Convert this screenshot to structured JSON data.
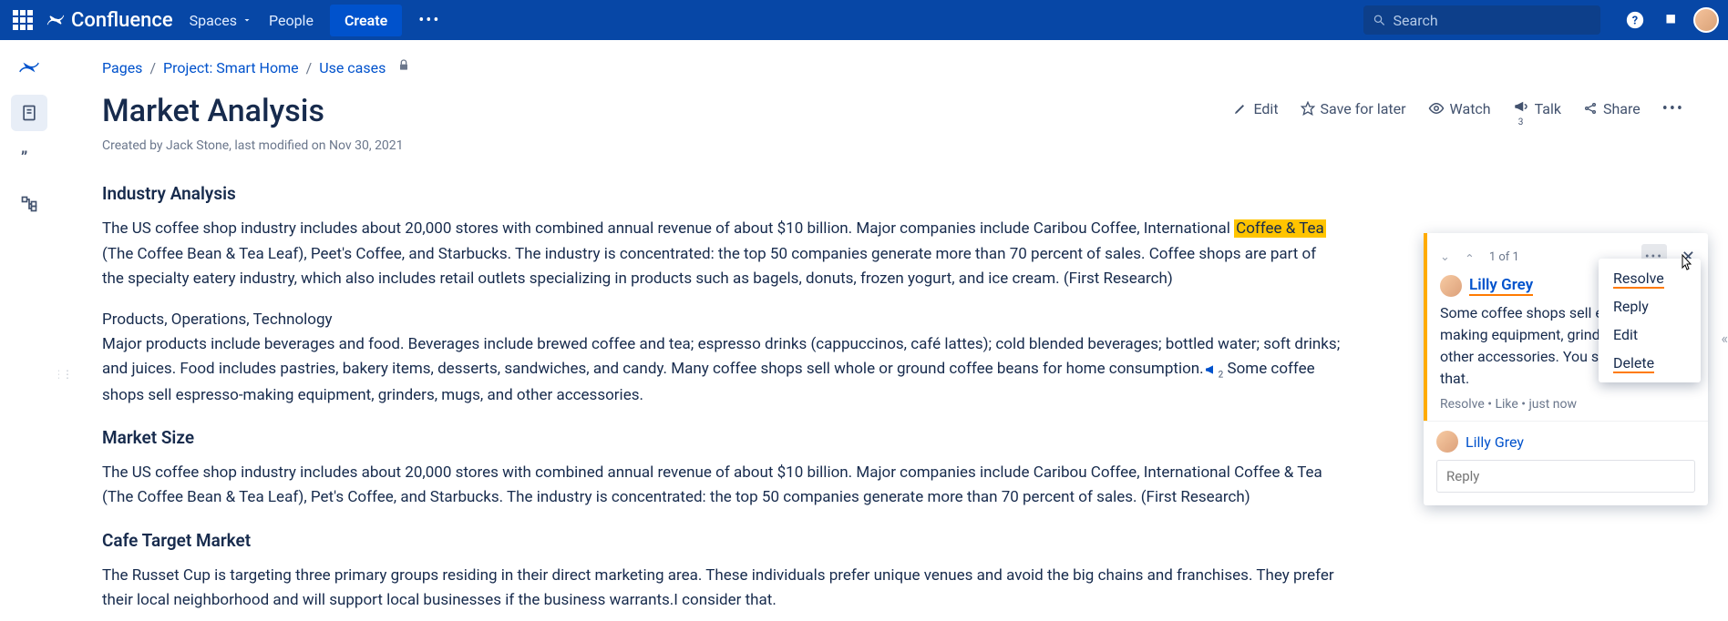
{
  "nav": {
    "brand": "Confluence",
    "spaces": "Spaces",
    "people": "People",
    "create": "Create",
    "search_placeholder": "Search"
  },
  "breadcrumbs": {
    "pages": "Pages",
    "project": "Project: Smart Home",
    "usecases": "Use cases"
  },
  "actions": {
    "edit": "Edit",
    "save": "Save for later",
    "watch": "Watch",
    "talk": "Talk",
    "share": "Share",
    "talk_count": "3"
  },
  "page": {
    "title": "Market Analysis",
    "byline": "Created by Jack Stone, last modified on Nov 30, 2021"
  },
  "article": {
    "h_industry": "Industry Analysis",
    "p_industry_a": "The US coffee shop industry includes about 20,000 stores with combined annual revenue of about $10 billion. Major companies include Caribou Coffee, International ",
    "p_industry_hl": "Coffee & Tea",
    "p_industry_b": " (The Coffee Bean & Tea Leaf), Peet's Coffee, and Starbucks. The industry is concentrated: the top 50 companies generate more than 70 percent of sales. Coffee shops are part of the specialty eatery industry, which also includes retail outlets specializing in products such as bagels, donuts, frozen yogurt, and ice cream. (First Research)",
    "p_products_head": "Products, Operations, Technology",
    "p_products_a": "Major products include beverages and food. Beverages include brewed coffee and tea; espresso drinks (cappuccinos, café lattes); cold blended beverages; bottled water; soft drinks; and juices. Food includes pastries, bakery items, desserts, sandwiches, and candy. Many coffee shops sell whole or ground coffee beans for home consumption.",
    "p_products_sub": "2",
    "p_products_b": " Some coffee shops sell espresso-making equipment, grinders, mugs, and other accessories.",
    "h_market": "Market Size",
    "p_market": "The US coffee shop industry includes about 20,000 stores with combined annual revenue of about $10 billion. Major companies include Caribou Coffee, International Coffee & Tea (The Coffee Bean & Tea Leaf), Pet's Coffee, and Starbucks. The industry is concentrated: the top 50 companies generate more than 70 percent of sales. (First Research)",
    "h_cafe": "Cafe Target Market",
    "p_cafe": "The Russet Cup is targeting three primary groups residing in their direct marketing area. These individuals prefer unique venues and avoid the big chains and franchises. They prefer their local neighborhood and will support local businesses if the business warrants.I consider that."
  },
  "comment": {
    "counter": "1 of 1",
    "author": "Lilly Grey",
    "body": "Some coffee shops sell espresso-making equipment, grinders, mugs, and other accessories. You should add that.",
    "footer": "Resolve • Like • just now",
    "reply_author": "Lilly Grey",
    "reply_placeholder": "Reply"
  },
  "ctx": {
    "resolve": "Resolve",
    "reply": "Reply",
    "edit": "Edit",
    "delete": "Delete"
  }
}
